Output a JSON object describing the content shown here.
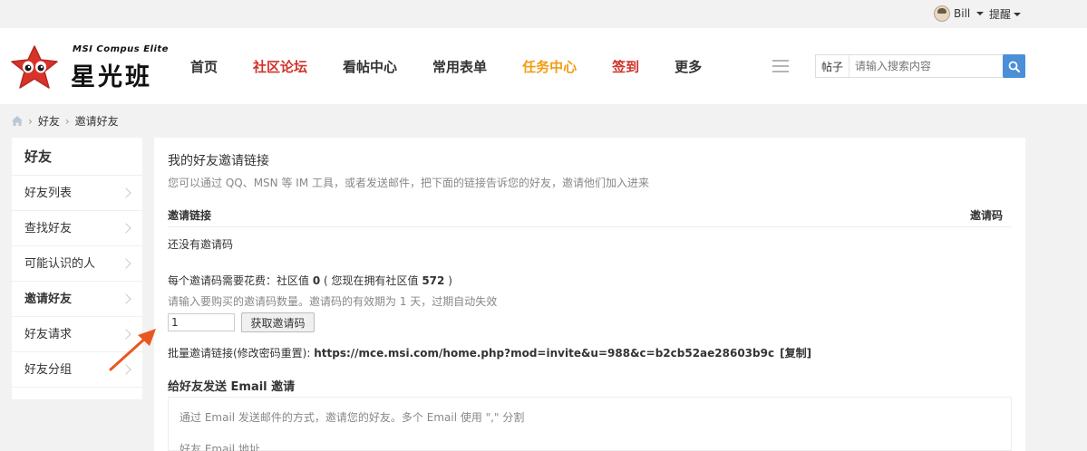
{
  "topbar": {
    "username": "Bill",
    "remind_label": "提醒"
  },
  "header": {
    "logo_small": "MSI Compus Elite",
    "logo_big": "星光班",
    "nav": [
      {
        "label": "首页",
        "color": "#333333"
      },
      {
        "label": "社区论坛",
        "color": "#d0322b"
      },
      {
        "label": "看帖中心",
        "color": "#333333"
      },
      {
        "label": "常用表单",
        "color": "#333333"
      },
      {
        "label": "任务中心",
        "color": "#f39c12"
      },
      {
        "label": "签到",
        "color": "#d0322b"
      },
      {
        "label": "更多",
        "color": "#333333"
      }
    ],
    "search": {
      "type_label": "帖子",
      "placeholder": "请输入搜索内容"
    }
  },
  "breadcrumb": {
    "items": [
      "好友",
      "邀请好友"
    ]
  },
  "sidebar": {
    "title": "好友",
    "items": [
      {
        "label": "好友列表",
        "active": false
      },
      {
        "label": "查找好友",
        "active": false
      },
      {
        "label": "可能认识的人",
        "active": false
      },
      {
        "label": "邀请好友",
        "active": true
      },
      {
        "label": "好友请求",
        "active": false
      },
      {
        "label": "好友分组",
        "active": false
      }
    ]
  },
  "main": {
    "title": "我的好友邀请链接",
    "description": "您可以通过 QQ、MSN 等 IM 工具，或者发送邮件，把下面的链接告诉您的好友，邀请他们加入进来",
    "table": {
      "col_link": "邀请链接",
      "col_code": "邀请码",
      "empty_text": "还没有邀请码"
    },
    "cost": {
      "prefix": "每个邀请码需要花费：社区值 ",
      "cost_value": "0",
      "middle": " ( 您现在拥有社区值 ",
      "owned_value": "572",
      "suffix": " )"
    },
    "hint": "请输入要购买的邀请码数量。邀请码的有效期为 1 天，过期自动失效",
    "quantity_value": "1",
    "get_button": "获取邀请码",
    "batch": {
      "label": "批量邀请链接(修改密码重置): ",
      "url": "https://mce.msi.com/home.php?mod=invite&u=988&c=b2cb52ae28603b9c",
      "copy": "[复制]"
    },
    "email": {
      "title": "给好友发送 Email 邀请",
      "description": "通过 Email 发送邮件的方式，邀请您的好友。多个 Email 使用 \",\" 分割",
      "field_label": "好友 Email 地址"
    }
  },
  "colors": {
    "accent_blue": "#4a8fd8",
    "brand_red": "#d0322b",
    "arrow_orange": "#e8571f"
  }
}
